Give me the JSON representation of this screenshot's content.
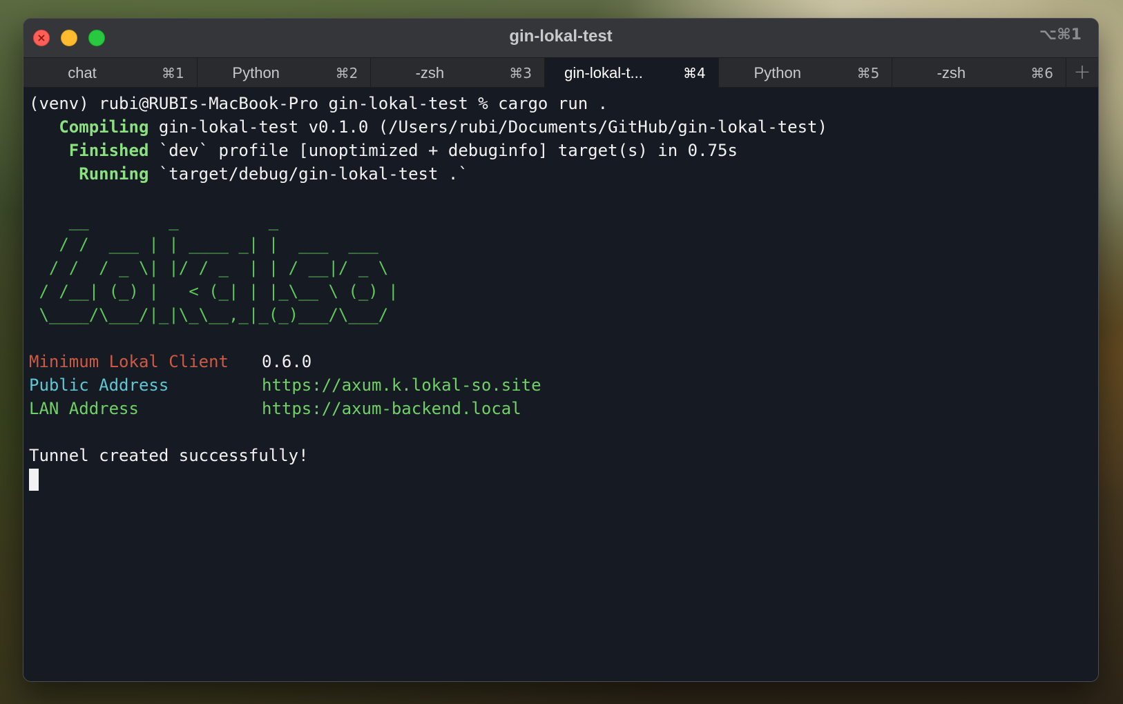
{
  "window": {
    "title": "gin-lokal-test",
    "shortcut": "⌥⌘1"
  },
  "tabs": [
    {
      "label": "chat",
      "shortcut": "⌘1",
      "active": false
    },
    {
      "label": "Python",
      "shortcut": "⌘2",
      "active": false
    },
    {
      "label": "-zsh",
      "shortcut": "⌘3",
      "active": false
    },
    {
      "label": "gin-lokal-t...",
      "shortcut": "⌘4",
      "active": true
    },
    {
      "label": "Python",
      "shortcut": "⌘5",
      "active": false
    },
    {
      "label": "-zsh",
      "shortcut": "⌘6",
      "active": false
    }
  ],
  "add_tab_glyph": "+",
  "terminal": {
    "prompt": "(venv) rubi@RUBIs-MacBook-Pro gin-lokal-test % cargo run .",
    "compiling_keyword": "Compiling",
    "compiling_text": " gin-lokal-test v0.1.0 (/Users/rubi/Documents/GitHub/gin-lokal-test)",
    "finished_keyword": "Finished",
    "finished_text": " `dev` profile [unoptimized + debuginfo] target(s) in 0.75s",
    "running_keyword": "Running",
    "running_text": " `target/debug/gin-lokal-test .`",
    "ascii_art": [
      "    __        _         _",
      "   / /  ___ | | ____ _| |  ___  ___",
      "  / /  / _ \\| |/ / _  | | / __|/ _ \\",
      " / /__| (_) |   < (_| | |_\\__ \\ (_) |",
      " \\____/\\___/|_|\\_\\__,_|_(_)___/\\___/"
    ],
    "info": [
      {
        "label": "Minimum Lokal Client",
        "value": "0.6.0",
        "label_color": "#cf5a43",
        "value_color": "#f2f2f2"
      },
      {
        "label": "Public Address",
        "value": "https://axum.k.lokal-so.site",
        "label_color": "#5ec7d4",
        "value_color": "#6fd166"
      },
      {
        "label": "LAN Address",
        "value": "https://axum-backend.local",
        "label_color": "#6fd166",
        "value_color": "#6fd166"
      }
    ],
    "status": "Tunnel created successfully!"
  }
}
